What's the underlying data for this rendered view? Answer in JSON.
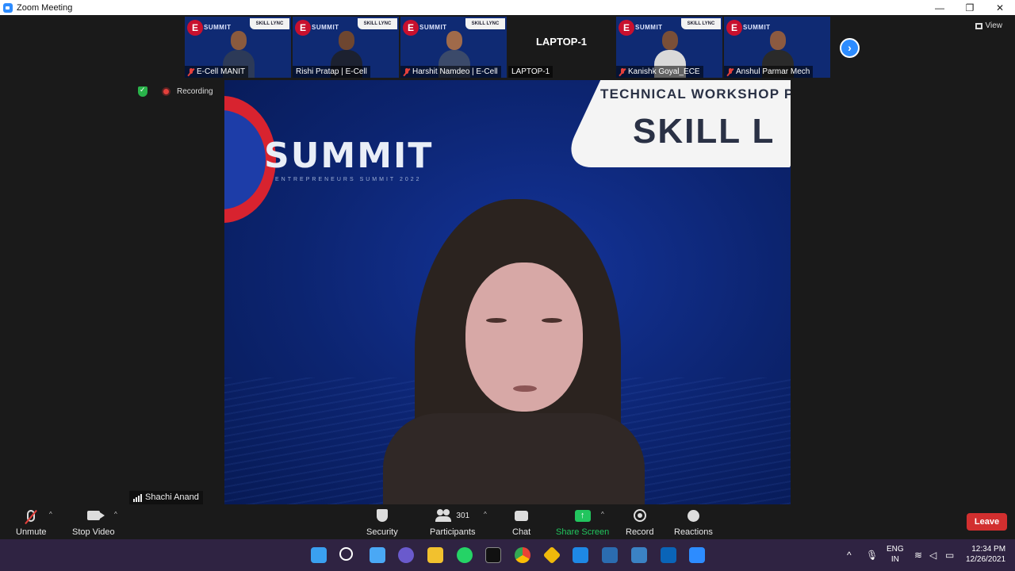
{
  "window": {
    "title": "Zoom Meeting",
    "controls": {
      "minimize": "—",
      "maximize": "❐",
      "close": "✕"
    }
  },
  "gallery": {
    "tiles": [
      {
        "name": "E-Cell MANIT",
        "muted": true,
        "video": true
      },
      {
        "name": "Rishi Pratap | E-Cell",
        "muted": false,
        "video": true
      },
      {
        "name": "Harshit Namdeo | E-Cell",
        "muted": true,
        "video": true
      },
      {
        "name": "LAPTOP-1",
        "muted": false,
        "video": false,
        "display_name": "LAPTOP-1"
      },
      {
        "name": "Kanishk Goyal_ECE",
        "muted": true,
        "video": true
      },
      {
        "name": "Anshul Parmar Mech",
        "muted": true,
        "video": true
      }
    ],
    "background": {
      "logo_letter": "E",
      "brand": "SUMMIT",
      "card": "SKILL LYNC"
    },
    "next_label": "›",
    "view_label": "View"
  },
  "recording": {
    "label": "Recording"
  },
  "main_video": {
    "speaker": "Shachi Anand",
    "background": {
      "brand": "SUMMIT",
      "subtitle": "ENTREPRENEURS SUMMIT 2022",
      "card_top": "TECHNICAL WORKSHOP PRE",
      "card_brand": "SKILL  L"
    }
  },
  "toolbar": {
    "unmute": "Unmute",
    "stop_video": "Stop Video",
    "security": "Security",
    "participants": "Participants",
    "participants_count": "301",
    "chat": "Chat",
    "share_screen": "Share Screen",
    "record": "Record",
    "reactions": "Reactions",
    "leave": "Leave",
    "caret": "^"
  },
  "taskbar": {
    "lang_top": "ENG",
    "lang_bottom": "IN",
    "time": "12:34 PM",
    "date": "12/26/2021",
    "chevron": "^"
  },
  "colors": {
    "zoom_blue": "#2d8cff",
    "leave_red": "#d22f2f",
    "share_green": "#22c55e",
    "taskbar": "#2f2342"
  }
}
